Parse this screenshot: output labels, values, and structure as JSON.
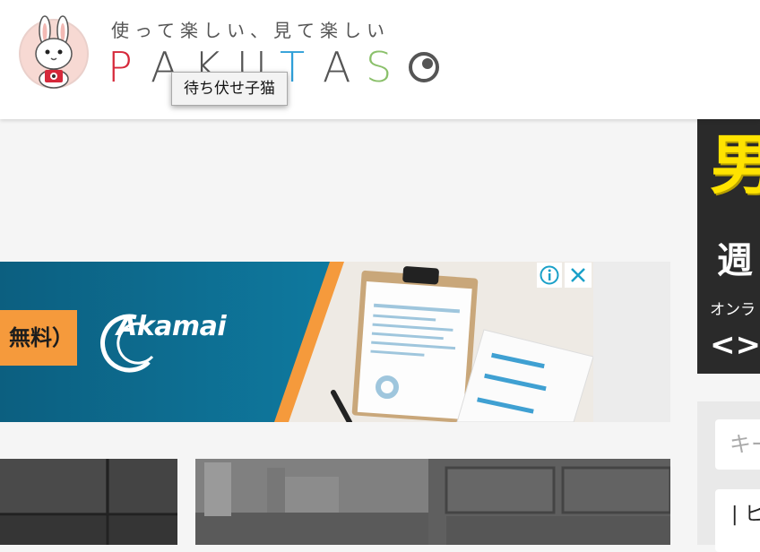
{
  "header": {
    "tagline": "使って楽しい、見て楽しい",
    "logo_letters": [
      {
        "char": "P",
        "color": "#d6283a"
      },
      {
        "char": "A",
        "color": "#555555"
      },
      {
        "char": "K",
        "color": "#555555"
      },
      {
        "char": "U",
        "color": "#555555"
      },
      {
        "char": "T",
        "color": "#2f9fd8"
      },
      {
        "char": "A",
        "color": "#555555"
      },
      {
        "char": "S",
        "color": "#8ac06a"
      }
    ]
  },
  "tooltip": {
    "text": "待ち伏せ子猫"
  },
  "ad": {
    "cta_text": "無料）",
    "brand": "Akamai"
  },
  "sidebar": {
    "ad_char_large": "男",
    "ad_char_week": "週",
    "ad_text_online": "オンラ",
    "ad_arrows": "<>",
    "search_placeholder": "キー",
    "category_text": "| ヒ"
  },
  "colors": {
    "brand_red": "#d6283a",
    "brand_blue": "#2f9fd8",
    "brand_green": "#8ac06a",
    "ad_orange": "#f59a3c",
    "ad_teal": "#0e6b8e"
  }
}
